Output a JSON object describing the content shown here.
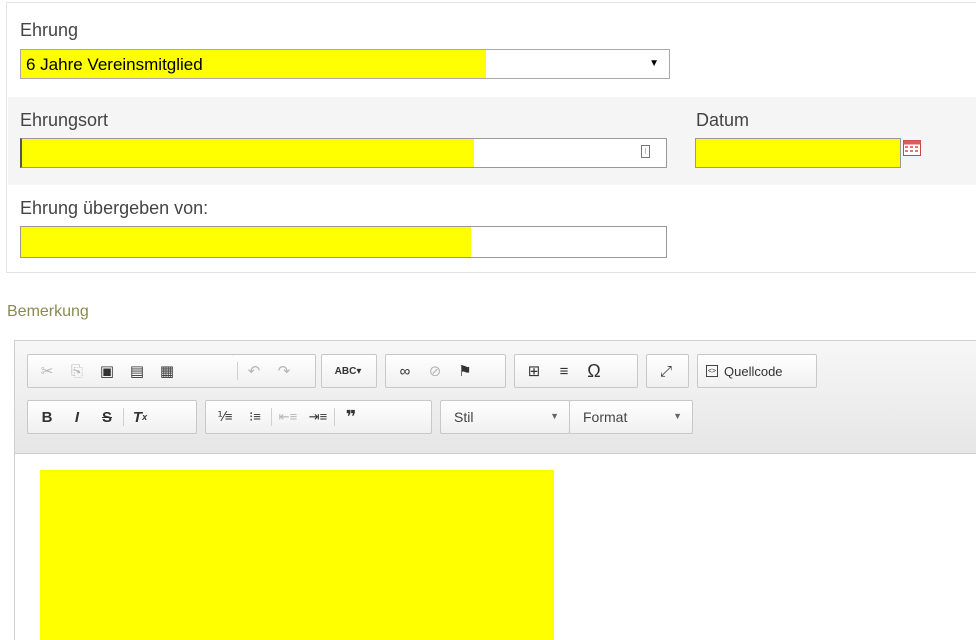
{
  "form": {
    "ehrung_label": "Ehrung",
    "ehrung_value": "6 Jahre Vereinsmitglied",
    "ehrungsort_label": "Ehrungsort",
    "datum_label": "Datum",
    "uebergeben_label": "Ehrung übergeben von:",
    "bemerkung_label": "Bemerkung"
  },
  "toolbar": {
    "row1": [
      [
        "cut-icon",
        "✂",
        false
      ],
      [
        "copy-icon",
        "⎘",
        false
      ],
      [
        "paste-icon",
        "📋",
        true
      ],
      [
        "paste-text-icon",
        "▤",
        true
      ],
      [
        "paste-word-icon",
        "▦",
        true
      ],
      [
        "undo-icon",
        "↶",
        false
      ],
      [
        "redo-icon",
        "↷",
        false
      ],
      [
        "spellcheck-icon",
        "ᴬᴮᶜ▾",
        true
      ],
      [
        "link-icon",
        "∞",
        true
      ],
      [
        "unlink-icon",
        "⊘",
        false
      ],
      [
        "anchor-icon",
        "⚑",
        true
      ],
      [
        "table-icon",
        "⊞",
        true
      ],
      [
        "horizontal-rule-icon",
        "≡",
        true
      ],
      [
        "special-char-icon",
        "Ω",
        true
      ],
      [
        "maximize-icon",
        "⤢",
        true
      ]
    ],
    "source_label": "Quellcode",
    "row2_format": [
      [
        "bold-icon",
        "B"
      ],
      [
        "italic-icon",
        "I"
      ],
      [
        "strike-icon",
        "S"
      ],
      [
        "remove-format-icon",
        "Tx"
      ]
    ],
    "row2_lists": [
      [
        "numbered-list-icon",
        "⒈≡",
        true
      ],
      [
        "bulleted-list-icon",
        "•≡",
        true
      ],
      [
        "outdent-icon",
        "⇤",
        false
      ],
      [
        "indent-icon",
        "⇥",
        true
      ],
      [
        "blockquote-icon",
        "❞",
        true
      ]
    ],
    "style_label": "Stil",
    "format_label": "Format"
  }
}
